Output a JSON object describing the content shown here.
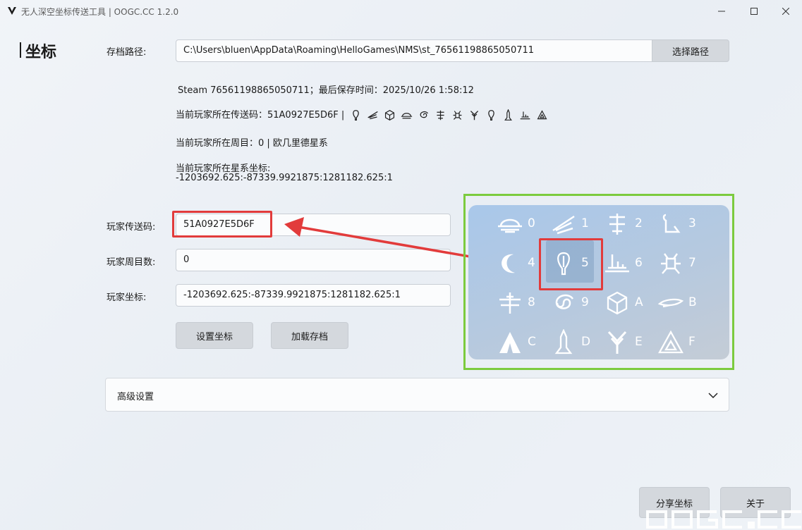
{
  "window": {
    "title": "无人深空坐标传送工具 | OOGC.CC 1.2.0",
    "minimize_icon": "minimize-icon",
    "maximize_icon": "maximize-icon",
    "close_icon": "close-icon"
  },
  "nav": {
    "page_title": "坐标"
  },
  "save_path": {
    "label": "存档路径:",
    "value": "C:\\Users\\bluen\\AppData\\Roaming\\HelloGames\\NMS\\st_76561198865050711",
    "button": "选择路径"
  },
  "info": {
    "steam_line": "Steam 76561198865050711；最后保存时间：2025/10/26 1:58:12",
    "portal_label": "当前玩家所在传送码：51A0927E5D6F |",
    "portal_glyph_sequence": [
      "5",
      "1",
      "A",
      "0",
      "9",
      "2",
      "7",
      "E",
      "5",
      "D",
      "6",
      "F"
    ],
    "galaxy_line": "当前玩家所在周目：0 | 欧几里德星系",
    "coord_label": "当前玩家所在星系坐标:",
    "coord_value": "-1203692.625:-87339.9921875:1281182.625:1"
  },
  "form": {
    "portal_label": "玩家传送码:",
    "portal_value": "51A0927E5D6F",
    "galaxy_label": "玩家周目数:",
    "galaxy_value": "0",
    "coord_label": "玩家坐标:",
    "coord_value": "-1203692.625:-87339.9921875:1281182.625:1",
    "set_button": "设置坐标",
    "load_button": "加载存档"
  },
  "glyph_panel": {
    "glyphs": [
      {
        "key": "0",
        "icon": "sunset-glyph-icon"
      },
      {
        "key": "1",
        "icon": "bird-glyph-icon"
      },
      {
        "key": "2",
        "icon": "face-glyph-icon"
      },
      {
        "key": "3",
        "icon": "diplo-glyph-icon"
      },
      {
        "key": "4",
        "icon": "eclipse-glyph-icon"
      },
      {
        "key": "5",
        "icon": "balloon-glyph-icon"
      },
      {
        "key": "6",
        "icon": "boat-glyph-icon"
      },
      {
        "key": "7",
        "icon": "bug-glyph-icon"
      },
      {
        "key": "8",
        "icon": "dragonfly-glyph-icon"
      },
      {
        "key": "9",
        "icon": "galaxy-glyph-icon"
      },
      {
        "key": "A",
        "icon": "voxel-glyph-icon"
      },
      {
        "key": "B",
        "icon": "fish-glyph-icon"
      },
      {
        "key": "C",
        "icon": "tent-glyph-icon"
      },
      {
        "key": "D",
        "icon": "rocket-glyph-icon"
      },
      {
        "key": "E",
        "icon": "tree-glyph-icon"
      },
      {
        "key": "F",
        "icon": "atlas-glyph-icon"
      }
    ],
    "selected": "5"
  },
  "advanced": {
    "label": "高级设置"
  },
  "footer": {
    "share_button": "分享坐标",
    "about_button": "关于"
  },
  "watermark": {
    "text": "OOGC.CC"
  },
  "colors": {
    "highlight": "#e23b3b",
    "frame": "#7ccb3e",
    "panel": "#a9c8ea"
  }
}
